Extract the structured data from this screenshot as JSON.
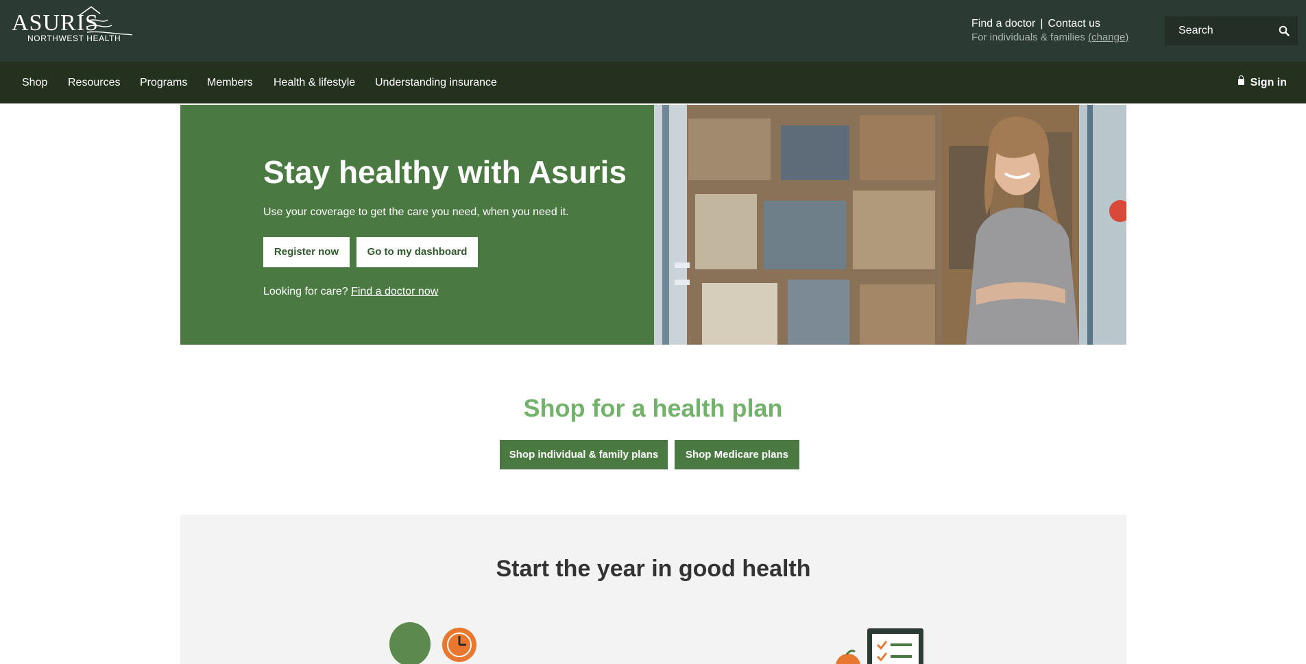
{
  "header": {
    "logo": {
      "wordmark": "ASURIS",
      "tagline": "NORTHWEST HEALTH"
    },
    "utility_links": [
      "Find a doctor",
      "Contact us"
    ],
    "audience_prefix": "For individuals & families",
    "audience_change": "(change)",
    "search_placeholder": "Search"
  },
  "nav": {
    "items": [
      "Shop",
      "Resources",
      "Programs",
      "Members",
      "Health & lifestyle",
      "Understanding insurance"
    ],
    "signin": "Sign in"
  },
  "hero": {
    "title": "Stay healthy with Asuris",
    "subtitle": "Use your coverage to get the care you need, when you need it.",
    "buttons": [
      "Register now",
      "Go to my dashboard"
    ],
    "care_prefix": "Looking for care?",
    "care_link": "Find a doctor now"
  },
  "shop": {
    "title": "Shop for a health plan",
    "buttons": [
      "Shop individual & family plans",
      "Shop Medicare plans"
    ]
  },
  "wellness": {
    "title": "Start the year in good health"
  },
  "colors": {
    "header_bg": "#2b3a32",
    "nav_bg": "#23311e",
    "hero_green": "#4a7a41",
    "shop_title_green": "#73b26b",
    "accent_orange": "#e8782f"
  }
}
